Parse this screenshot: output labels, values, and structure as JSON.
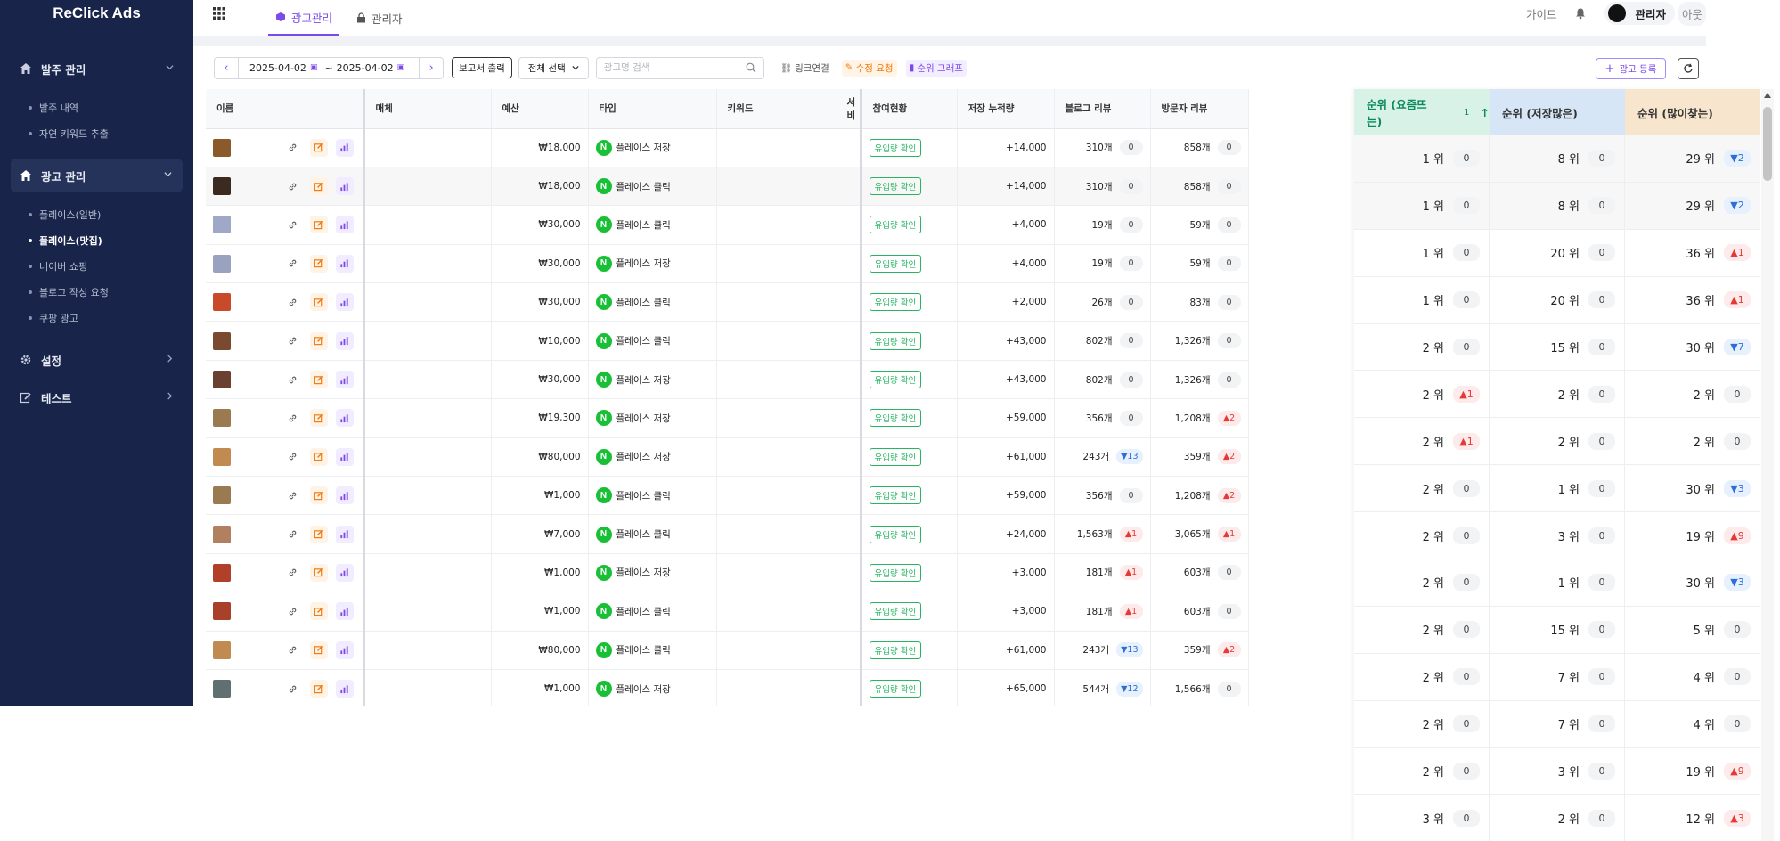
{
  "brand": "ReClick Ads",
  "sidebar": {
    "groups": [
      {
        "label": "발주 관리",
        "items": [
          "발주 내역",
          "자연 키워드 추출"
        ]
      },
      {
        "label": "광고 관리",
        "items": [
          "플레이스(일반)",
          "플레이스(맛집)",
          "네이버 쇼핑",
          "블로그 작성 요청",
          "쿠팡 광고"
        ]
      },
      {
        "label": "설정"
      },
      {
        "label": "테스트"
      }
    ]
  },
  "topbar": {
    "tab_ads": "광고관리",
    "tab_admin": "관리자",
    "guide": "가이드",
    "user": "관리자",
    "logout": "아웃"
  },
  "toolbar": {
    "date_from": "2025-04-02",
    "date_sep": "~",
    "date_to": "2025-04-02",
    "report": "보고서 출력",
    "select_all": "전체 선택",
    "search_placeholder": "광고명 검색",
    "link": "링크연결",
    "edit_req": "수정 요청",
    "rank_graph": "순위 그래프",
    "add": "광고 등록"
  },
  "columns": {
    "name": "이름",
    "media": "매체",
    "budget": "예산",
    "type": "타입",
    "keyword": "키워드",
    "service": "서비",
    "participation": "참여현황",
    "saves": "저장 누적량",
    "blog": "블로그 리뷰",
    "visitor": "방문자 리뷰"
  },
  "inflow_label": "유입량 확인",
  "rank_columns": {
    "c1": "순위 (요즘뜨는)",
    "c1_sort": "1",
    "c2": "순위 (저장많은)",
    "c3": "순위 (많이찾는)"
  },
  "rows": [
    {
      "budget": "₩18,000",
      "type": "플레이스 저장",
      "saves": "+14,000",
      "blog": "310개",
      "blog_chg": "0",
      "visitor": "858개",
      "visitor_chg": "0",
      "thumb": "#8a5a2a"
    },
    {
      "budget": "₩18,000",
      "type": "플레이스 클릭",
      "saves": "+14,000",
      "blog": "310개",
      "blog_chg": "0",
      "visitor": "858개",
      "visitor_chg": "0",
      "thumb": "#3b2a20"
    },
    {
      "budget": "₩30,000",
      "type": "플레이스 클릭",
      "saves": "+4,000",
      "blog": "19개",
      "blog_chg": "0",
      "visitor": "59개",
      "visitor_chg": "0",
      "thumb": "#a0a8c8"
    },
    {
      "budget": "₩30,000",
      "type": "플레이스 저장",
      "saves": "+4,000",
      "blog": "19개",
      "blog_chg": "0",
      "visitor": "59개",
      "visitor_chg": "0",
      "thumb": "#9aa2c0"
    },
    {
      "budget": "₩30,000",
      "type": "플레이스 클릭",
      "saves": "+2,000",
      "blog": "26개",
      "blog_chg": "0",
      "visitor": "83개",
      "visitor_chg": "0",
      "thumb": "#c84a2a"
    },
    {
      "budget": "₩10,000",
      "type": "플레이스 클릭",
      "saves": "+43,000",
      "blog": "802개",
      "blog_chg": "0",
      "visitor": "1,326개",
      "visitor_chg": "0",
      "thumb": "#7a4a30"
    },
    {
      "budget": "₩30,000",
      "type": "플레이스 저장",
      "saves": "+43,000",
      "blog": "802개",
      "blog_chg": "0",
      "visitor": "1,326개",
      "visitor_chg": "0",
      "thumb": "#6a4030"
    },
    {
      "budget": "₩19,300",
      "type": "플레이스 저장",
      "saves": "+59,000",
      "blog": "356개",
      "blog_chg": "0",
      "visitor": "1,208개",
      "visitor_chg": "▲2",
      "thumb": "#9a7a50"
    },
    {
      "budget": "₩80,000",
      "type": "플레이스 저장",
      "saves": "+61,000",
      "blog": "243개",
      "blog_chg": "▼13",
      "visitor": "359개",
      "visitor_chg": "▲2",
      "thumb": "#c08a50"
    },
    {
      "budget": "₩1,000",
      "type": "플레이스 클릭",
      "saves": "+59,000",
      "blog": "356개",
      "blog_chg": "0",
      "visitor": "1,208개",
      "visitor_chg": "▲2",
      "thumb": "#9a7a50"
    },
    {
      "budget": "₩7,000",
      "type": "플레이스 클릭",
      "saves": "+24,000",
      "blog": "1,563개",
      "blog_chg": "▲1",
      "visitor": "3,065개",
      "visitor_chg": "▲1",
      "thumb": "#b08060"
    },
    {
      "budget": "₩1,000",
      "type": "플레이스 저장",
      "saves": "+3,000",
      "blog": "181개",
      "blog_chg": "▲1",
      "visitor": "603개",
      "visitor_chg": "0",
      "thumb": "#b0402a"
    },
    {
      "budget": "₩1,000",
      "type": "플레이스 클릭",
      "saves": "+3,000",
      "blog": "181개",
      "blog_chg": "▲1",
      "visitor": "603개",
      "visitor_chg": "0",
      "thumb": "#a8402a"
    },
    {
      "budget": "₩80,000",
      "type": "플레이스 클릭",
      "saves": "+61,000",
      "blog": "243개",
      "blog_chg": "▼13",
      "visitor": "359개",
      "visitor_chg": "▲2",
      "thumb": "#c08a50"
    },
    {
      "budget": "₩1,000",
      "type": "플레이스 저장",
      "saves": "+65,000",
      "blog": "544개",
      "blog_chg": "▼12",
      "visitor": "1,566개",
      "visitor_chg": "0",
      "thumb": "#607070"
    }
  ],
  "ranks": [
    {
      "r1": "1 위",
      "c1": "0",
      "r2": "8 위",
      "c2": "0",
      "r3": "29 위",
      "c3": "▼2"
    },
    {
      "r1": "1 위",
      "c1": "0",
      "r2": "8 위",
      "c2": "0",
      "r3": "29 위",
      "c3": "▼2"
    },
    {
      "r1": "1 위",
      "c1": "0",
      "r2": "20 위",
      "c2": "0",
      "r3": "36 위",
      "c3": "▲1"
    },
    {
      "r1": "1 위",
      "c1": "0",
      "r2": "20 위",
      "c2": "0",
      "r3": "36 위",
      "c3": "▲1"
    },
    {
      "r1": "2 위",
      "c1": "0",
      "r2": "15 위",
      "c2": "0",
      "r3": "30 위",
      "c3": "▼7"
    },
    {
      "r1": "2 위",
      "c1": "▲1",
      "r2": "2 위",
      "c2": "0",
      "r3": "2 위",
      "c3": "0"
    },
    {
      "r1": "2 위",
      "c1": "▲1",
      "r2": "2 위",
      "c2": "0",
      "r3": "2 위",
      "c3": "0"
    },
    {
      "r1": "2 위",
      "c1": "0",
      "r2": "1 위",
      "c2": "0",
      "r3": "30 위",
      "c3": "▼3"
    },
    {
      "r1": "2 위",
      "c1": "0",
      "r2": "3 위",
      "c2": "0",
      "r3": "19 위",
      "c3": "▲9"
    },
    {
      "r1": "2 위",
      "c1": "0",
      "r2": "1 위",
      "c2": "0",
      "r3": "30 위",
      "c3": "▼3"
    },
    {
      "r1": "2 위",
      "c1": "0",
      "r2": "15 위",
      "c2": "0",
      "r3": "5 위",
      "c3": "0"
    },
    {
      "r1": "2 위",
      "c1": "0",
      "r2": "7 위",
      "c2": "0",
      "r3": "4 위",
      "c3": "0"
    },
    {
      "r1": "2 위",
      "c1": "0",
      "r2": "7 위",
      "c2": "0",
      "r3": "4 위",
      "c3": "0"
    },
    {
      "r1": "2 위",
      "c1": "0",
      "r2": "3 위",
      "c2": "0",
      "r3": "19 위",
      "c3": "▲9"
    },
    {
      "r1": "3 위",
      "c1": "0",
      "r2": "2 위",
      "c2": "0",
      "r3": "12 위",
      "c3": "▲3"
    }
  ],
  "colors": {
    "sidebar": "#18244a",
    "accent": "#7c4ae8",
    "naver": "#19c037",
    "inflow": "#28b463",
    "up": "#e53935",
    "down": "#2b6fd6"
  }
}
